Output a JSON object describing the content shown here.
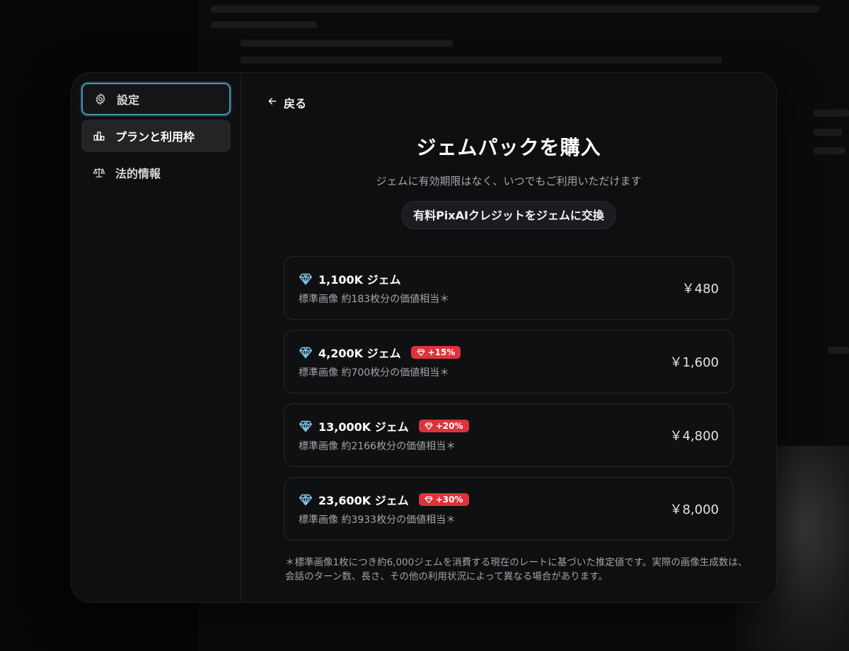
{
  "sidebar": {
    "items": [
      {
        "label": "設定",
        "icon": "gear-icon"
      },
      {
        "label": "プランと利用枠",
        "icon": "bar-chart-icon"
      },
      {
        "label": "法的情報",
        "icon": "scale-icon"
      }
    ]
  },
  "main": {
    "back_label": "戻る",
    "title": "ジェムパックを購入",
    "subtitle": "ジェムに有効期限はなく、いつでもご利用いただけます",
    "exchange_button": "有料PixAIクレジットをジェムに交換",
    "packs": [
      {
        "name": "1,100K ジェム",
        "bonus": "",
        "desc": "標準画像 約183枚分の価値相当＊",
        "price": "￥480"
      },
      {
        "name": "4,200K ジェム",
        "bonus": "+15%",
        "desc": "標準画像 約700枚分の価値相当＊",
        "price": "￥1,600"
      },
      {
        "name": "13,000K ジェム",
        "bonus": "+20%",
        "desc": "標準画像 約2166枚分の価値相当＊",
        "price": "￥4,800"
      },
      {
        "name": "23,600K ジェム",
        "bonus": "+30%",
        "desc": "標準画像 約3933枚分の価値相当＊",
        "price": "￥8,000"
      }
    ],
    "footnote_line1": "＊標準画像1枚につき約6,000ジェムを消費する現在のレートに基づいた推定値です。実際の画像生成数は、",
    "footnote_line2": "会話のターン数、長さ、その他の利用状況によって異なる場合があります。"
  },
  "colors": {
    "accent_focus": "#4d94b4",
    "bonus_badge": "#e0323a",
    "gem": "#7fc6e6"
  }
}
